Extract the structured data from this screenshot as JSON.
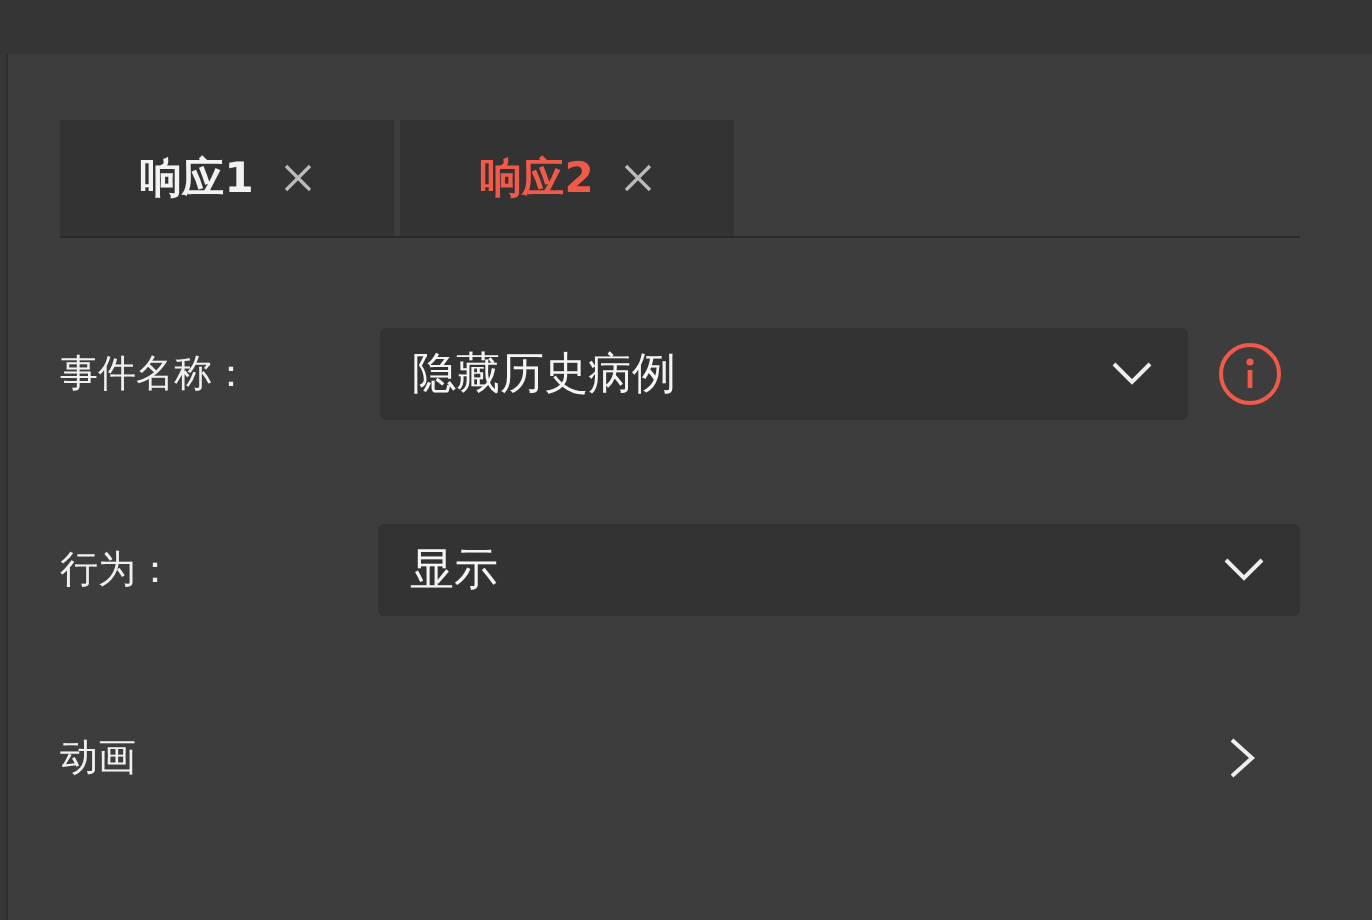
{
  "tabs": [
    {
      "label": "响应1",
      "selected": false
    },
    {
      "label": "响应2",
      "selected": true
    }
  ],
  "fields": [
    {
      "label": "事件名称：",
      "value": "隐藏历史病例",
      "info": true
    },
    {
      "label": "行为：",
      "value": "显示",
      "info": false
    }
  ],
  "animation": {
    "label": "动画",
    "expanded": false
  }
}
